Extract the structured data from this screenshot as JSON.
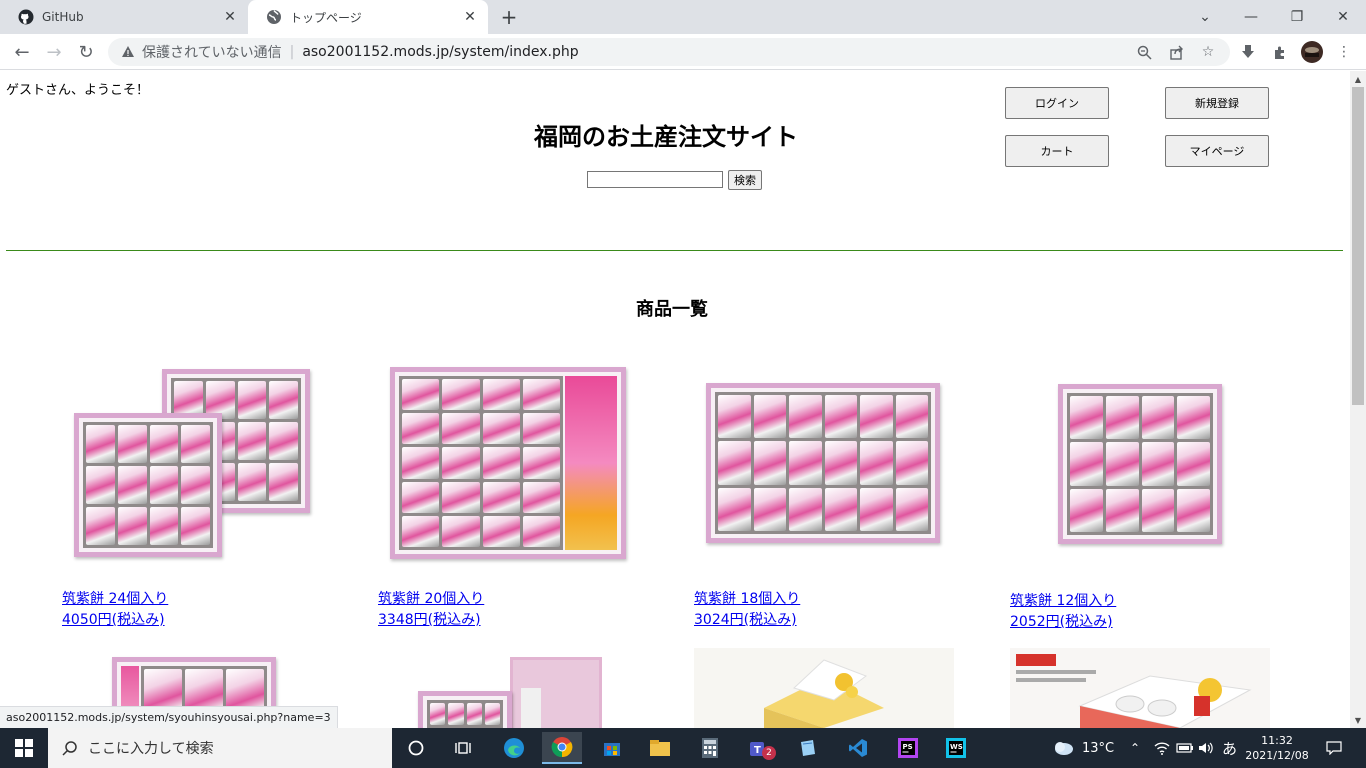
{
  "browser": {
    "tabs": [
      {
        "title": "GitHub",
        "icon": "github-icon",
        "active": false
      },
      {
        "title": "トップページ",
        "icon": "globe-icon",
        "active": true
      }
    ],
    "security_text": "保護されていない通信",
    "url": "aso2001152.mods.jp/system/index.php",
    "status_url": "aso2001152.mods.jp/system/syouhinsyousai.php?name=3"
  },
  "page": {
    "welcome": "ゲストさん、ようこそ！",
    "site_title": "福岡のお土産注文サイト",
    "search_button": "検索",
    "search_value": "",
    "buttons": {
      "login": "ログイン",
      "register": "新規登録",
      "cart": "カート",
      "mypage": "マイページ"
    },
    "section_title": "商品一覧",
    "products": [
      {
        "name": "筑紫餅 24個入り",
        "price": "4050円(税込み)"
      },
      {
        "name": "筑紫餅 20個入り",
        "price": "3348円(税込み)"
      },
      {
        "name": "筑紫餅 18個入り",
        "price": "3024円(税込み)"
      },
      {
        "name": "筑紫餅 12個入り",
        "price": "2052円(税込み)"
      }
    ]
  },
  "taskbar": {
    "search_placeholder": "ここに入力して検索",
    "teams_badge": "2",
    "weather": "13°C",
    "ime": "あ",
    "time": "11:32",
    "date": "2021/12/08"
  },
  "colors": {
    "link": "#0000ee",
    "divider": "#3a8a1a",
    "taskbar": "#1d2733"
  }
}
